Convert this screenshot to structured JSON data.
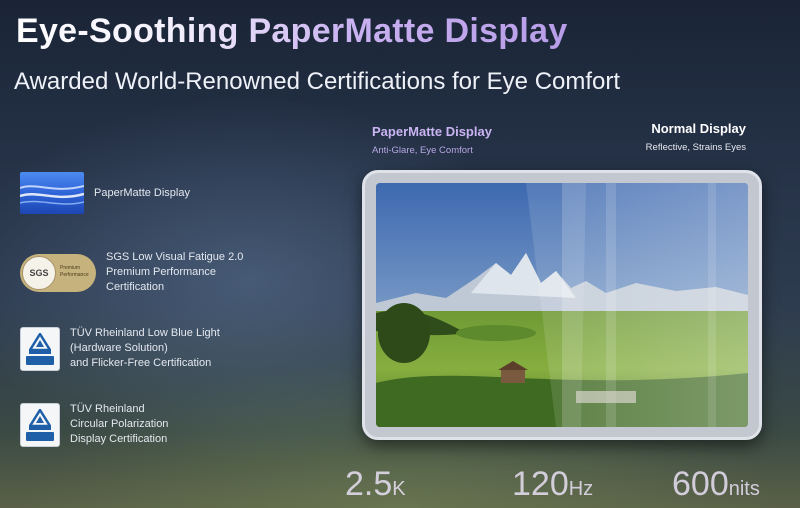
{
  "header": {
    "title": "Eye-Soothing PaperMatte Display",
    "subtitle": "Awarded World-Renowned Certifications for Eye Comfort"
  },
  "certifications": [
    {
      "icon": "papermatte-logo-icon",
      "lines": [
        "PaperMatte Display"
      ]
    },
    {
      "icon": "sgs-badge-icon",
      "badge_text": "SGS",
      "badge_tag": [
        "Premium",
        "Performance"
      ],
      "lines": [
        "SGS Low Visual Fatigue 2.0",
        "Premium Performance",
        "Certification"
      ]
    },
    {
      "icon": "tuv-badge-icon",
      "lines": [
        "TÜV Rheinland Low Blue Light",
        "(Hardware Solution)",
        "and Flicker-Free Certification"
      ]
    },
    {
      "icon": "tuv-badge-icon",
      "lines": [
        "TÜV Rheinland",
        "Circular Polarization",
        "Display Certification"
      ]
    }
  ],
  "comparison": {
    "left": {
      "title": "PaperMatte Display",
      "subtitle": "Anti-Glare, Eye Comfort"
    },
    "right": {
      "title": "Normal Display",
      "subtitle": "Reflective, Strains Eyes"
    }
  },
  "specs": [
    {
      "value": "2.5",
      "unit": "K"
    },
    {
      "value": "120",
      "unit": "Hz"
    },
    {
      "value": "600",
      "unit": "nits"
    }
  ],
  "colors": {
    "accent_purple": "#c9b4f2",
    "background_dark": "#1a2436",
    "tuv_blue": "#1f5fa8",
    "sgs_gold": "#c6b27c"
  }
}
